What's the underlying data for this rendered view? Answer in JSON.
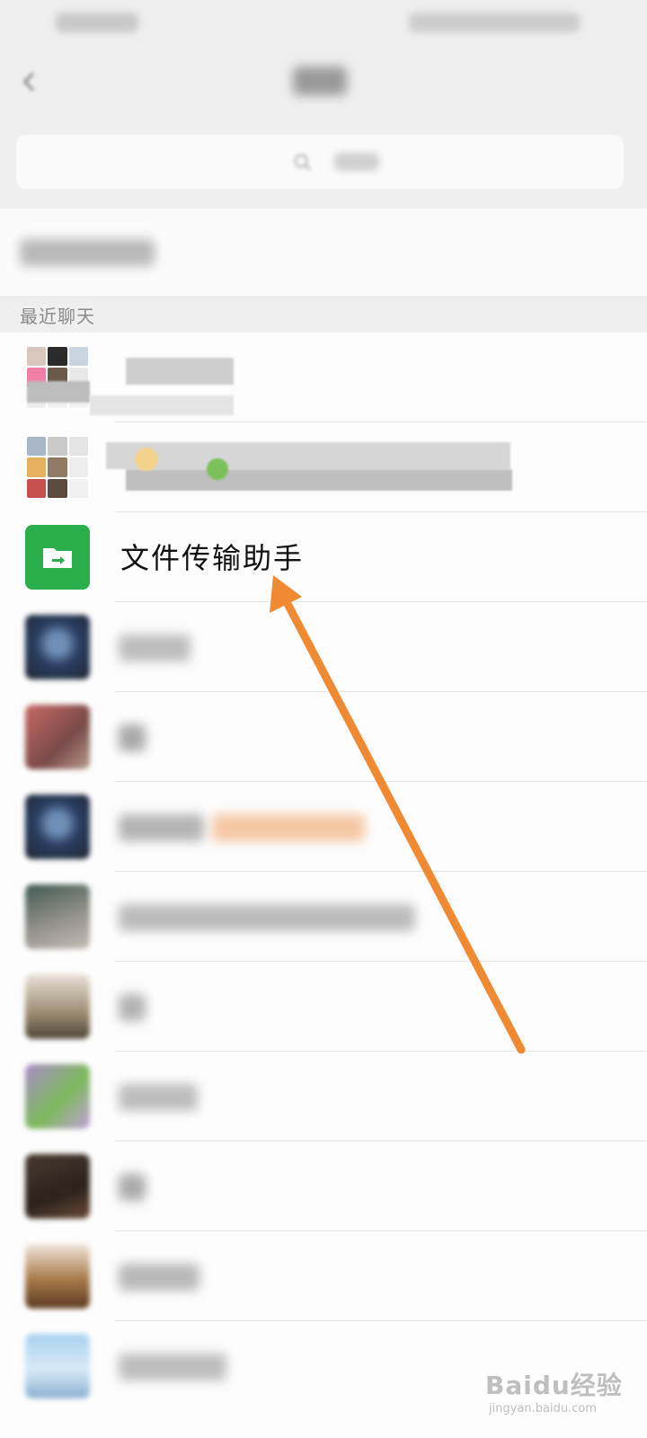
{
  "section": {
    "recent_chats_label": "最近聊天"
  },
  "chats": {
    "file_transfer": {
      "name": "文件传输助手"
    }
  },
  "watermark": {
    "brand": "Baidu经验",
    "url": "jingyan.baidu.com"
  },
  "colors": {
    "accent": "#2aae4c",
    "arrow": "#f08a32",
    "background": "#efefef"
  },
  "icons": {
    "back": "chevron-left-icon",
    "search": "search-icon",
    "file": "folder-arrow-icon"
  }
}
